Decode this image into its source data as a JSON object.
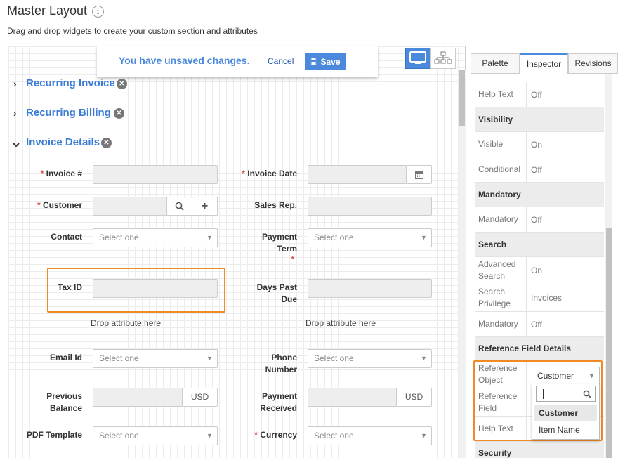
{
  "header": {
    "title": "Master Layout",
    "info_icon": "i",
    "subtitle": "Drag and drop widgets to create your custom section and attributes"
  },
  "notice": {
    "text": "You have unsaved changes.",
    "cancel_label": "Cancel",
    "save_label": "Save"
  },
  "view_toggle": {
    "desktop_icon": "monitor-icon",
    "tree_icon": "hierarchy-icon"
  },
  "sections": [
    {
      "label": "Recurring Invoice",
      "expanded": false
    },
    {
      "label": "Recurring Billing",
      "expanded": false
    },
    {
      "label": "Invoice Details",
      "expanded": true
    }
  ],
  "form": {
    "invoice_no": {
      "label": "Invoice #",
      "required": "*"
    },
    "invoice_date": {
      "label": "Invoice Date",
      "required": "*"
    },
    "customer": {
      "label": "Customer",
      "required": "*"
    },
    "sales_rep": {
      "label": "Sales Rep."
    },
    "contact": {
      "label": "Contact",
      "placeholder": "Select one"
    },
    "payment_term": {
      "label_line1": "Payment",
      "label_line2": "Term",
      "required": "*",
      "placeholder": "Select one"
    },
    "tax_id": {
      "label": "Tax ID"
    },
    "days_past_due": {
      "label_line1": "Days Past",
      "label_line2": "Due"
    },
    "drop_hint": "Drop attribute here",
    "email_id": {
      "label": "Email Id",
      "placeholder": "Select one"
    },
    "phone_number": {
      "label_line1": "Phone",
      "label_line2": "Number",
      "placeholder": "Select one"
    },
    "previous_balance": {
      "label_line1": "Previous",
      "label_line2": "Balance",
      "currency": "USD"
    },
    "payment_received": {
      "label_line1": "Payment",
      "label_line2": "Received",
      "currency": "USD"
    },
    "pdf_template": {
      "label": "PDF Template",
      "placeholder": "Select one"
    },
    "currency": {
      "label": "Currency",
      "required": "*",
      "placeholder": "Select one"
    }
  },
  "panel": {
    "tabs": [
      "Palette",
      "Inspector",
      "Revisions"
    ],
    "active_tab": "Inspector",
    "rows": {
      "help_text_1": {
        "key": "Help Text",
        "value": "Off"
      },
      "visibility_header": "Visibility",
      "visible": {
        "key": "Visible",
        "value": "On"
      },
      "conditional": {
        "key": "Conditional",
        "value": "Off"
      },
      "mandatory_header": "Mandatory",
      "mandatory_1": {
        "key": "Mandatory",
        "value": "Off"
      },
      "search_header": "Search",
      "advanced_search": {
        "key_line1": "Advanced",
        "key_line2": "Search",
        "value": "On"
      },
      "search_privilege": {
        "key_line1": "Search",
        "key_line2": "Privilege",
        "value": "Invoices"
      },
      "mandatory_2": {
        "key": "Mandatory",
        "value": "Off"
      },
      "ref_header": "Reference Field Details",
      "ref_object": {
        "key_line1": "Reference",
        "key_line2": "Object",
        "value": "Customer"
      },
      "ref_field": {
        "key_line1": "Reference",
        "key_line2": "Field"
      },
      "help_text_2": {
        "key": "Help Text"
      },
      "security_header": "Security"
    },
    "dropdown": {
      "search_value": "",
      "options": [
        "Customer",
        "Item Name"
      ],
      "highlighted": "Customer"
    }
  },
  "colors": {
    "accent": "#4a89dc",
    "highlight_border": "#f08a24",
    "required": "#d9534f"
  }
}
